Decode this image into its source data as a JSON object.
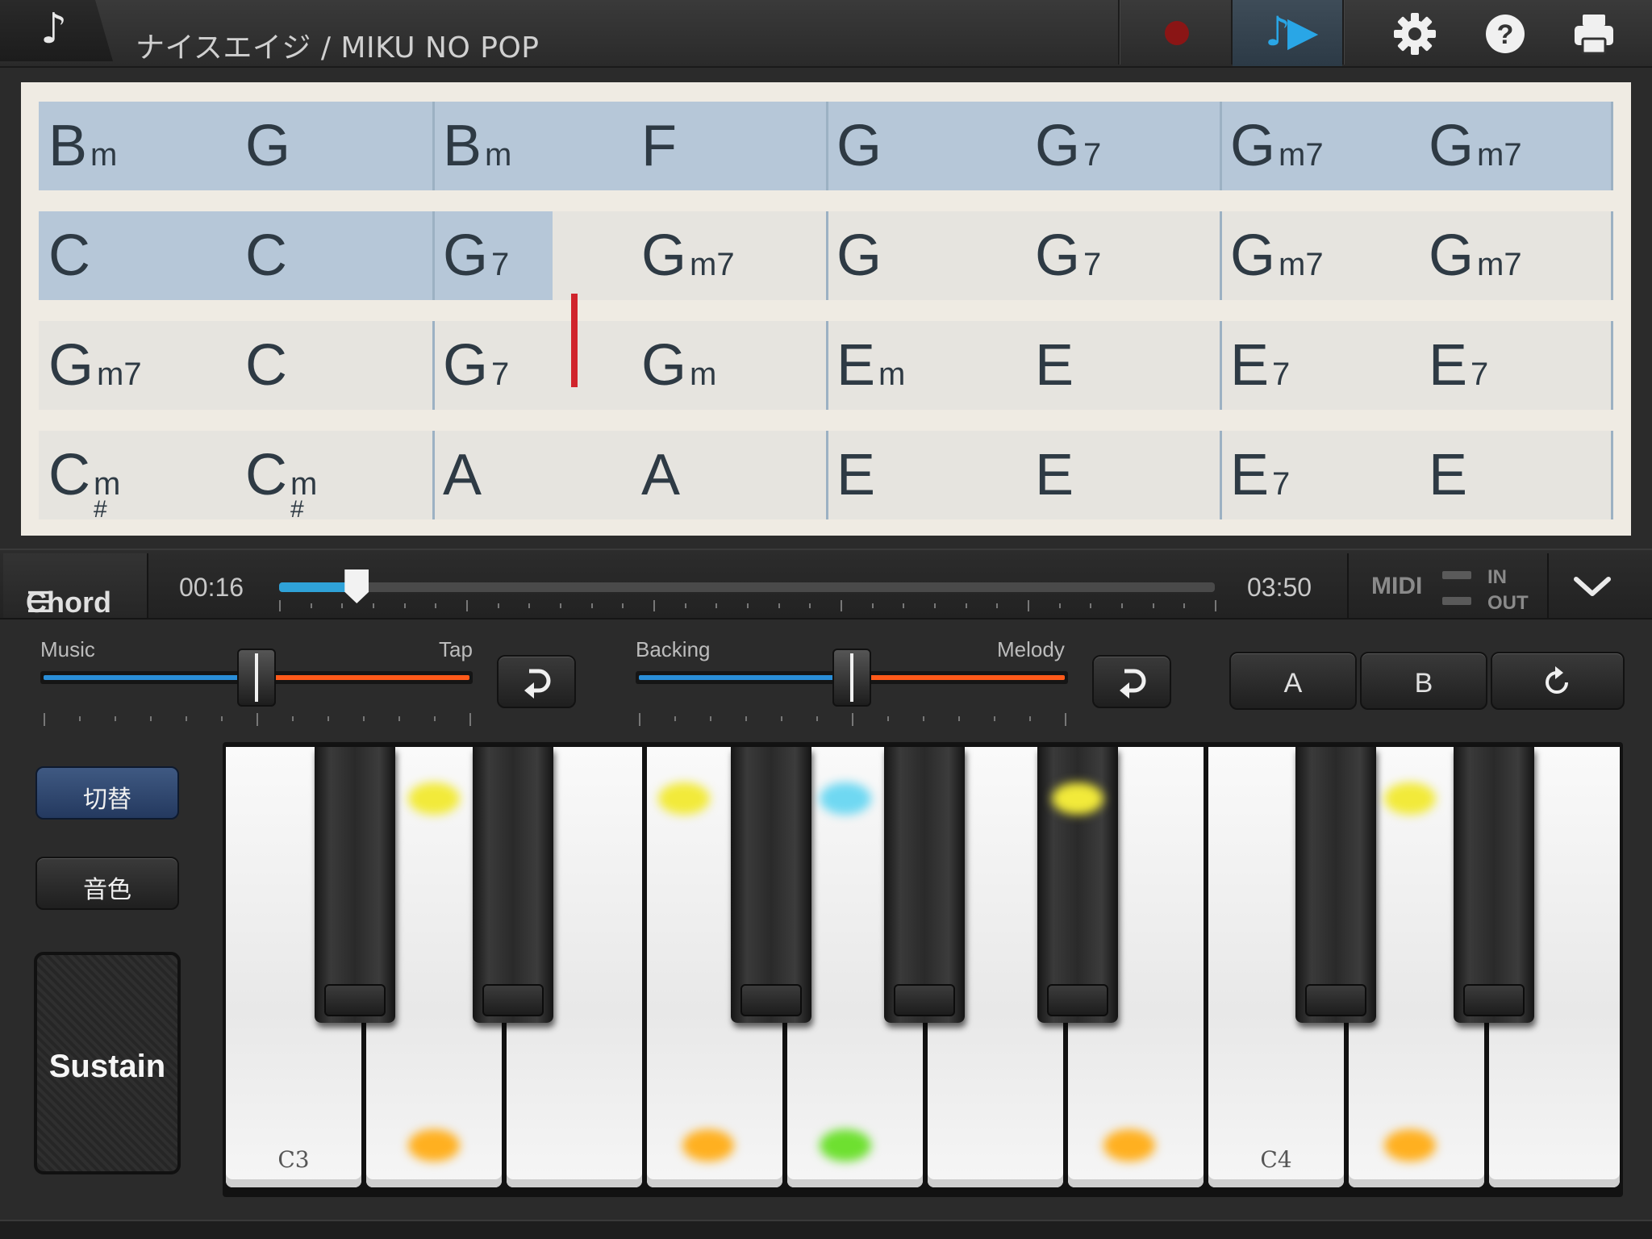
{
  "header": {
    "app_icon": "music-note-icon",
    "song_title": "ナイスエイジ / MIKU NO POP",
    "buttons": [
      "record-icon",
      "play-song-icon",
      "gear-icon",
      "help-icon",
      "print-icon"
    ]
  },
  "chord_chart": {
    "rows": [
      {
        "measures": [
          [
            {
              "root": "B",
              "q": "m"
            },
            {
              "root": "G",
              "q": ""
            }
          ],
          [
            {
              "root": "B",
              "q": "m"
            },
            {
              "root": "F",
              "q": ""
            }
          ],
          [
            {
              "root": "G",
              "q": ""
            },
            {
              "root": "G",
              "q": "7"
            }
          ],
          [
            {
              "root": "G",
              "q": "m7"
            },
            {
              "root": "G",
              "q": "m7"
            }
          ]
        ]
      },
      {
        "measures": [
          [
            {
              "root": "C",
              "q": ""
            },
            {
              "root": "C",
              "q": ""
            }
          ],
          [
            {
              "root": "G",
              "q": "7"
            },
            {
              "root": "G",
              "q": "m7"
            }
          ],
          [
            {
              "root": "G",
              "q": ""
            },
            {
              "root": "G",
              "q": "7"
            }
          ],
          [
            {
              "root": "G",
              "q": "m7"
            },
            {
              "root": "G",
              "q": "m7"
            }
          ]
        ]
      },
      {
        "measures": [
          [
            {
              "root": "G",
              "q": "m7"
            },
            {
              "root": "C",
              "q": ""
            }
          ],
          [
            {
              "root": "G",
              "q": "7"
            },
            {
              "root": "G",
              "q": "m"
            }
          ],
          [
            {
              "root": "E",
              "q": "m"
            },
            {
              "root": "E",
              "q": ""
            }
          ],
          [
            {
              "root": "E",
              "q": "7"
            },
            {
              "root": "E",
              "q": "7"
            }
          ]
        ]
      },
      {
        "measures": [
          [
            {
              "root": "C",
              "sharp": "#",
              "q": "m"
            },
            {
              "root": "C",
              "sharp": "#",
              "q": "m"
            }
          ],
          [
            {
              "root": "A",
              "q": ""
            },
            {
              "root": "A",
              "q": ""
            }
          ],
          [
            {
              "root": "E",
              "q": ""
            },
            {
              "root": "E",
              "q": ""
            }
          ],
          [
            {
              "root": "E",
              "q": "7"
            },
            {
              "root": "E",
              "q": ""
            }
          ]
        ]
      }
    ]
  },
  "transport": {
    "menu_label": "Chord",
    "current_time": "00:16",
    "total_time": "03:50",
    "progress": 0.083,
    "midi_label": "MIDI",
    "midi_in": "IN",
    "midi_out": "OUT"
  },
  "mixer": {
    "left_label": "Music",
    "right_label": "Tap",
    "left_balance": 0.5,
    "backing_label": "Backing",
    "melody_label": "Melody",
    "backing_balance": 0.5
  },
  "ab_repeat": {
    "a_label": "A",
    "b_label": "B",
    "reset_icon": "refresh-icon"
  },
  "controls": {
    "switch_label": "切替",
    "tone_label": "音色",
    "sustain_label": "Sustain"
  },
  "keyboard": {
    "white_keys": [
      "C3",
      "",
      "",
      "",
      "",
      "",
      "",
      "C4",
      "",
      ""
    ],
    "glow_colors": {
      "yellow": "#f2ea3a",
      "cyan": "#6fd8f2",
      "orange": "#ffb020",
      "green": "#6ee030"
    }
  },
  "colors": {
    "highlight_measure": "#b6c7d8",
    "playhead": "#d0242c",
    "progress_fill": "#2fa2d8",
    "slider_blue": "#2a8ed8",
    "slider_orange": "#ff5a1a"
  }
}
